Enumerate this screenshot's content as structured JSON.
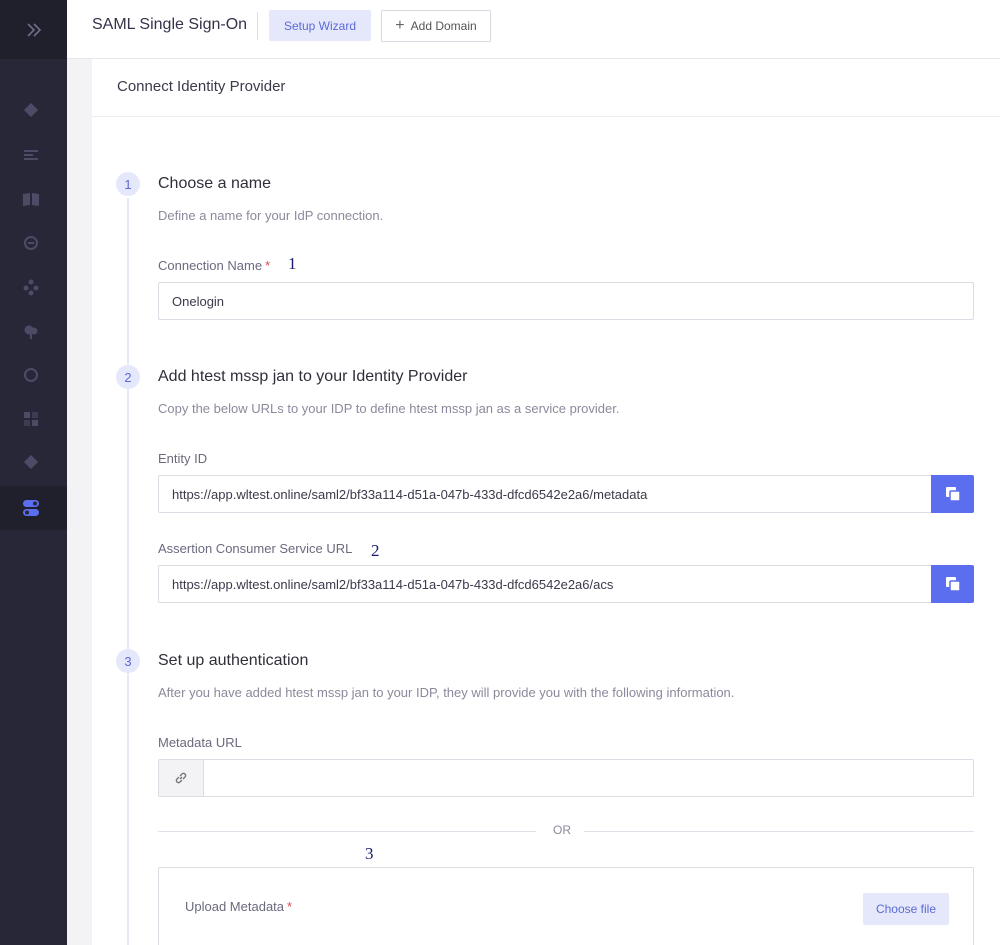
{
  "sidebar": {
    "toggle_icon": "double-chevron-right-icon",
    "items": [
      {
        "icon": "layers-icon"
      },
      {
        "icon": "list-icon"
      },
      {
        "icon": "book-icon"
      },
      {
        "icon": "circle-target-icon"
      },
      {
        "icon": "nodes-icon"
      },
      {
        "icon": "cloud-icon"
      },
      {
        "icon": "circle-icon"
      },
      {
        "icon": "grid-icon"
      },
      {
        "icon": "layers-alt-icon"
      },
      {
        "icon": "toggle-icon",
        "active": true
      }
    ]
  },
  "header": {
    "title": "SAML Single Sign-On",
    "setup_wizard_label": "Setup Wizard",
    "add_domain_label": "Add Domain"
  },
  "panel": {
    "title": "Connect Identity Provider"
  },
  "step1": {
    "number": "1",
    "title": "Choose a name",
    "description": "Define a name for your IdP connection.",
    "connection_name_label": "Connection Name",
    "required_mark": "*",
    "annotation": "1",
    "connection_name_value": "Onelogin"
  },
  "step2": {
    "number": "2",
    "title": "Add htest mssp jan to your Identity Provider",
    "description": "Copy the below URLs to your IDP to define htest mssp jan as a service provider.",
    "entity_id_label": "Entity ID",
    "entity_id_value": "https://app.wltest.online/saml2/bf33a114-d51a-047b-433d-dfcd6542e2a6/metadata",
    "acs_label": "Assertion Consumer Service URL",
    "annotation": "2",
    "acs_value": "https://app.wltest.online/saml2/bf33a114-d51a-047b-433d-dfcd6542e2a6/acs"
  },
  "step3": {
    "number": "3",
    "title": "Set up authentication",
    "description": "After you have added htest mssp jan to your IDP, they will provide you with the following information.",
    "metadata_url_label": "Metadata URL",
    "metadata_url_value": "",
    "or_text": "OR",
    "annotation": "3",
    "upload_label": "Upload Metadata",
    "required_mark": "*",
    "choose_file_label": "Choose file"
  },
  "colors": {
    "sidebar_bg": "#272738",
    "accent": "#5c6ef0",
    "accent_light": "#e5e7fb",
    "required": "#e04a4a"
  }
}
